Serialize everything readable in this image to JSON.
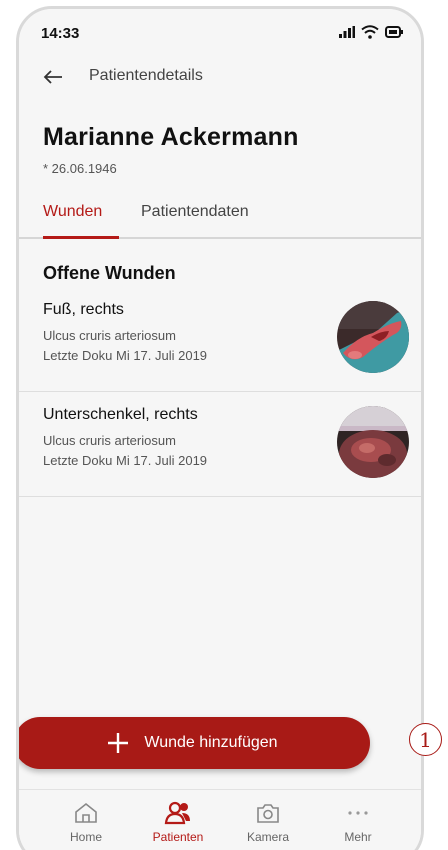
{
  "status_bar": {
    "time": "14:33"
  },
  "app_bar": {
    "title": "Patientendetails"
  },
  "patient": {
    "name": "Marianne Ackermann",
    "birth_date": "* 26.06.1946"
  },
  "tabs": [
    {
      "label": "Wunden",
      "active": true
    },
    {
      "label": "Patientendaten",
      "active": false
    }
  ],
  "wounds_section": {
    "title": "Offene Wunden"
  },
  "wounds": [
    {
      "location": "Fuß, rechts",
      "diagnosis": "Ulcus cruris arteriosum",
      "last_doc": "Letzte Doku Mi 17. Juli 2019"
    },
    {
      "location": "Unterschenkel, rechts",
      "diagnosis": "Ulcus cruris arteriosum",
      "last_doc": "Letzte Doku Mi 17. Juli 2019"
    }
  ],
  "add_button": {
    "label": "Wunde hinzufügen",
    "icon": "plus-icon"
  },
  "callout": {
    "number": "1"
  },
  "bottom_nav": [
    {
      "label": "Home",
      "icon": "home-icon",
      "active": false
    },
    {
      "label": "Patienten",
      "icon": "patients-icon",
      "active": true
    },
    {
      "label": "Kamera",
      "icon": "camera-icon",
      "active": false
    },
    {
      "label": "Mehr",
      "icon": "more-icon",
      "active": false
    }
  ],
  "colors": {
    "accent": "#b41a17",
    "button": "#a81a16",
    "background": "#f6f6f6"
  }
}
